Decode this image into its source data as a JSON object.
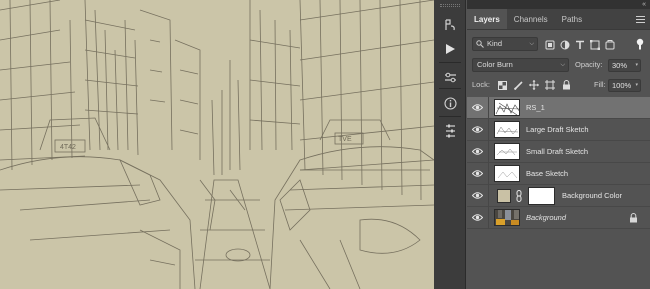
{
  "panel": {
    "tabs": [
      {
        "label": "Layers",
        "active": true
      },
      {
        "label": "Channels",
        "active": false
      },
      {
        "label": "Paths",
        "active": false
      }
    ],
    "collapse_glyph": "«",
    "filter": {
      "kind_label": "Kind",
      "icons": [
        "pixel-filter-icon",
        "adjustment-filter-icon",
        "type-filter-icon",
        "shape-filter-icon",
        "smart-object-filter-icon",
        "filter-toggle-icon"
      ]
    },
    "blend": {
      "mode": "Color Burn",
      "opacity_label": "Opacity:",
      "opacity_value": "30%"
    },
    "lock": {
      "label": "Lock:",
      "icons": [
        "lock-transparent-pixels-icon",
        "lock-image-pixels-icon",
        "lock-position-icon",
        "lock-artboard-icon",
        "lock-all-icon"
      ],
      "fill_label": "Fill:",
      "fill_value": "100%"
    },
    "layers": [
      {
        "name": "RS_1",
        "selected": true,
        "kind": "pixel",
        "visible": true
      },
      {
        "name": "Large Draft Sketch",
        "selected": false,
        "kind": "pixel",
        "visible": true
      },
      {
        "name": "Small Draft Sketch",
        "selected": false,
        "kind": "pixel",
        "visible": true
      },
      {
        "name": "Base Sketch",
        "selected": false,
        "kind": "pixel",
        "visible": true
      },
      {
        "name": "Background Color",
        "selected": false,
        "kind": "fill",
        "visible": true,
        "swatch_color": "#c9c1a5"
      },
      {
        "name": "Background",
        "selected": false,
        "kind": "background",
        "visible": true,
        "italic": true,
        "locked": true
      }
    ]
  },
  "toolstrip": {
    "icons": [
      "history-icon",
      "actions-play-icon",
      "adjustments-icon",
      "info-icon",
      "properties-icon"
    ]
  },
  "colors": {
    "panel_bg": "#535353",
    "tab_bar": "#424242",
    "selected_row": "#727272",
    "canvas_paper": "#cbc5a8"
  }
}
